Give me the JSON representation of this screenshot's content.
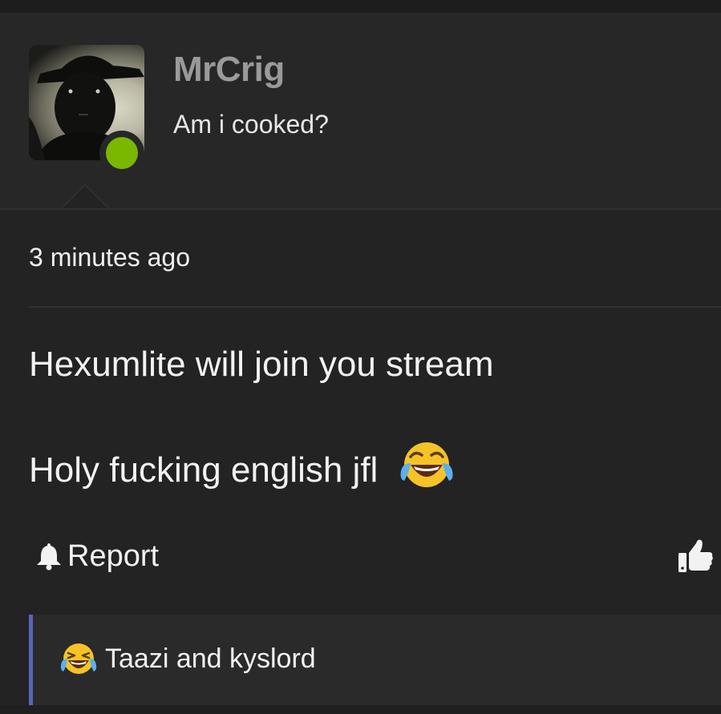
{
  "post": {
    "author": {
      "name": "MrCrig",
      "status_text": "Am i cooked?",
      "online": true,
      "status_color": "#7ab800"
    },
    "timestamp": "3 minutes ago",
    "message": {
      "line1": "Hexumlite will join you stream",
      "line2": "Holy fucking english jfl",
      "line2_emoji": "face-with-tears-of-joy-icon"
    },
    "actions": {
      "report_label": "Report",
      "report_icon": "bell-icon",
      "like_icon": "thumbs-up-icon"
    },
    "reaction": {
      "emoji": "loudly-crying-laughing-face-icon",
      "text": "Taazi and kyslord",
      "accent_color": "#5a63b8"
    }
  }
}
